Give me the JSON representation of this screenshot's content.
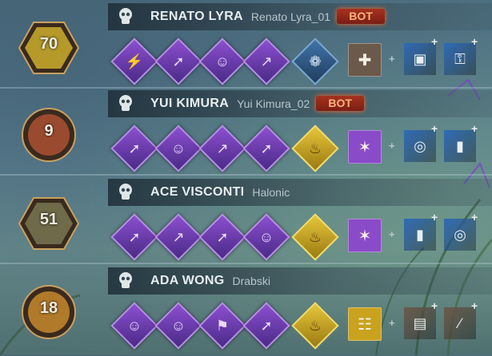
{
  "players": [
    {
      "name": "RENATO LYRA",
      "handle": "Renato Lyra_01",
      "badge": "BOT",
      "level": "70",
      "offering": "blue",
      "item_color": "#6b5a4b",
      "addon_colors": [
        "#2f6bb6",
        "#2f6bb6"
      ],
      "perk_icons": [
        "bolt",
        "run",
        "bust",
        "leap"
      ],
      "item_icon": "medkit-icon",
      "addon_icons": [
        "bag-icon",
        "lock-icon"
      ]
    },
    {
      "name": "YUI KIMURA",
      "handle": "Yui Kimura_02",
      "badge": "BOT",
      "level": "9",
      "offering": "gold",
      "item_color": "#8a4bc8",
      "addon_colors": [
        "#2f6bb6",
        "#2f6bb6"
      ],
      "perk_icons": [
        "run",
        "bust",
        "leap",
        "run"
      ],
      "item_icon": "flashlight-icon",
      "addon_icons": [
        "ring-icon",
        "battery-icon"
      ]
    },
    {
      "name": "ACE VISCONTI",
      "handle": "Halonic",
      "badge": "",
      "level": "51",
      "offering": "gold",
      "item_color": "#8a4bc8",
      "addon_colors": [
        "#2f6bb6",
        "#2f6bb6"
      ],
      "perk_icons": [
        "run",
        "leap",
        "run",
        "bust"
      ],
      "item_icon": "flashlight-icon",
      "addon_icons": [
        "battery-icon",
        "ring-icon"
      ]
    },
    {
      "name": "ADA WONG",
      "handle": "Drabski",
      "badge": "",
      "level": "18",
      "offering": "gold",
      "item_color": "#c9a21e",
      "addon_colors": [
        "#6b5a4b",
        "#6b5a4b"
      ],
      "perk_icons": [
        "bust",
        "bust",
        "sneak",
        "run"
      ],
      "item_icon": "map-icon",
      "addon_icons": [
        "stamp-icon",
        "stick-icon"
      ]
    }
  ],
  "colors": {
    "bot_badge": "#a6321f",
    "perk_purple": "#8c4fd0",
    "offering_gold": "#c9a21e",
    "offering_blue": "#2f5f8e",
    "addon_blue": "#2f6bb6",
    "addon_brown": "#6b5a4b"
  }
}
